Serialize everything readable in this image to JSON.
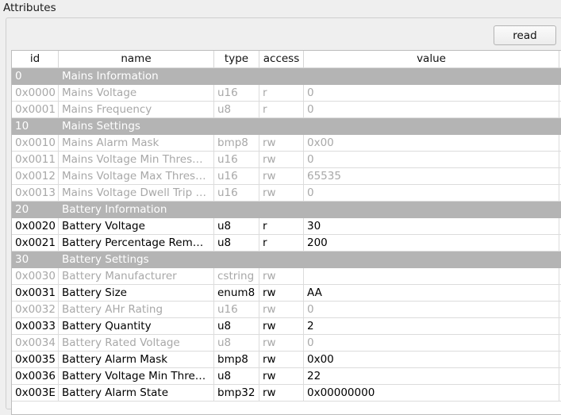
{
  "group": {
    "title": "Attributes"
  },
  "toolbar": {
    "read_label": "read"
  },
  "columns": {
    "id": "id",
    "name": "name",
    "type": "type",
    "access": "access",
    "value": "value"
  },
  "rows": [
    {
      "kind": "section",
      "id": "0",
      "name": "Mains Information"
    },
    {
      "kind": "disabled",
      "id": "0x0000",
      "name": "Mains Voltage",
      "type": "u16",
      "access": "r",
      "value": "0"
    },
    {
      "kind": "disabled",
      "id": "0x0001",
      "name": "Mains Frequency",
      "type": "u8",
      "access": "r",
      "value": "0"
    },
    {
      "kind": "section",
      "id": "10",
      "name": "Mains Settings"
    },
    {
      "kind": "disabled",
      "id": "0x0010",
      "name": "Mains Alarm Mask",
      "type": "bmp8",
      "access": "rw",
      "value": "0x00"
    },
    {
      "kind": "disabled",
      "id": "0x0011",
      "name": "Mains Voltage Min Thres…",
      "type": "u16",
      "access": "rw",
      "value": "0"
    },
    {
      "kind": "disabled",
      "id": "0x0012",
      "name": "Mains Voltage Max Thres…",
      "type": "u16",
      "access": "rw",
      "value": "65535"
    },
    {
      "kind": "disabled",
      "id": "0x0013",
      "name": "Mains Voltage Dwell Trip …",
      "type": "u16",
      "access": "rw",
      "value": "0"
    },
    {
      "kind": "section",
      "id": "20",
      "name": "Battery Information"
    },
    {
      "kind": "enabled",
      "id": "0x0020",
      "name": "Battery Voltage",
      "type": "u8",
      "access": "r",
      "value": "30"
    },
    {
      "kind": "enabled",
      "id": "0x0021",
      "name": "Battery Percentage Rem…",
      "type": "u8",
      "access": "r",
      "value": "200"
    },
    {
      "kind": "section",
      "id": "30",
      "name": "Battery Settings"
    },
    {
      "kind": "disabled",
      "id": "0x0030",
      "name": "Battery Manufacturer",
      "type": "cstring",
      "access": "rw",
      "value": ""
    },
    {
      "kind": "enabled",
      "id": "0x0031",
      "name": "Battery Size",
      "type": "enum8",
      "access": "rw",
      "value": "AA"
    },
    {
      "kind": "disabled",
      "id": "0x0032",
      "name": "Battery AHr Rating",
      "type": "u16",
      "access": "rw",
      "value": "0"
    },
    {
      "kind": "enabled",
      "id": "0x0033",
      "name": "Battery Quantity",
      "type": "u8",
      "access": "rw",
      "value": "2"
    },
    {
      "kind": "disabled",
      "id": "0x0034",
      "name": "Battery Rated Voltage",
      "type": "u8",
      "access": "rw",
      "value": "0"
    },
    {
      "kind": "enabled",
      "id": "0x0035",
      "name": "Battery Alarm Mask",
      "type": "bmp8",
      "access": "rw",
      "value": "0x00"
    },
    {
      "kind": "enabled",
      "id": "0x0036",
      "name": "Battery Voltage Min Thre…",
      "type": "u8",
      "access": "rw",
      "value": "22"
    },
    {
      "kind": "enabled",
      "id": "0x003E",
      "name": "Battery Alarm State",
      "type": "bmp32",
      "access": "rw",
      "value": "0x00000000"
    }
  ],
  "colors": {
    "section_bg": "#b4b4b4",
    "section_text": "#ffffff",
    "disabled_text": "#a8a8a8",
    "enabled_text": "#000000"
  }
}
